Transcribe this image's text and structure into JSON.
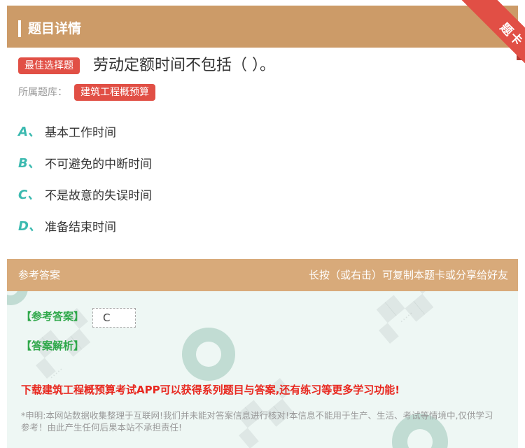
{
  "header": {
    "title": "题目详情"
  },
  "ribbon": {
    "label": "题卡"
  },
  "question": {
    "type_badge": "最佳选择题",
    "text": "劳动定额时间不包括（ ）。",
    "bank_label": "所属题库：",
    "bank_name": "建筑工程概预算"
  },
  "options": [
    {
      "letter": "A、",
      "text": "基本工作时间"
    },
    {
      "letter": "B、",
      "text": "不可避免的中断时间"
    },
    {
      "letter": "C、",
      "text": "不是故意的失误时间"
    },
    {
      "letter": "D、",
      "text": "准备结束时间"
    }
  ],
  "answer_section": {
    "title": "参考答案",
    "hint": "长按（或右击）可复制本题卡或分享给好友",
    "answer_label": "【参考答案】",
    "answer_value": "C",
    "analysis_label": "【答案解析】",
    "promo": "下载建筑工程概预算考试APP可以获得系列题目与答案,还有练习等更多学习功能!",
    "disclaimer": "*申明:本网站数据收集整理于互联网!我们并未能对答案信息进行核对!本信息不能用于生产、生活、考试等情境中,仅供学习参考！由此产生任何后果本站不承担责任!"
  },
  "colors": {
    "header_bg": "#cc9b68",
    "answer_header_bg": "#d8aa7a",
    "badge_red": "#e14f45",
    "option_letter": "#3cbab0",
    "answer_green": "#2fa84a",
    "promo_red": "#e8281f",
    "answer_body_bg": "#eef7f4"
  }
}
